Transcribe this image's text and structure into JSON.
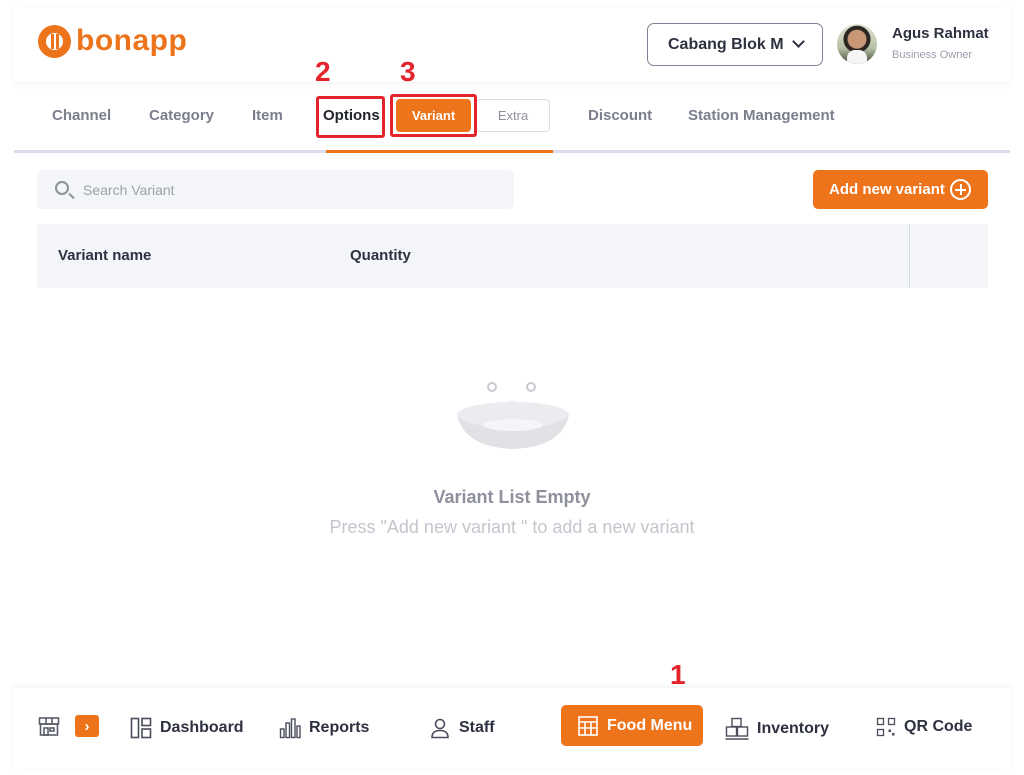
{
  "app": {
    "logo_text": "bonapp"
  },
  "header": {
    "branch": "Cabang Blok M",
    "user_name": "Agus Rahmat",
    "user_role": "Business Owner"
  },
  "tabs": [
    {
      "label": "Channel"
    },
    {
      "label": "Category"
    },
    {
      "label": "Item"
    },
    {
      "label": "Options"
    },
    {
      "label": "Discount"
    },
    {
      "label": "Station Management"
    }
  ],
  "options_sub": {
    "variant": "Variant",
    "extra": "Extra"
  },
  "search": {
    "placeholder": "Search Variant"
  },
  "add_button": "Add new variant",
  "table": {
    "col_name": "Variant name",
    "col_quantity": "Quantity"
  },
  "empty": {
    "title": "Variant List Empty",
    "subtitle": "Press \"Add new variant \" to add a new variant"
  },
  "bottom_nav": {
    "dashboard": "Dashboard",
    "reports": "Reports",
    "staff": "Staff",
    "food_menu": "Food Menu",
    "inventory": "Inventory",
    "qr_code": "QR Code"
  },
  "annotations": {
    "n1": "1",
    "n2": "2",
    "n3": "3"
  },
  "colors": {
    "accent": "#ee741c",
    "annotation": "#e3242b"
  }
}
